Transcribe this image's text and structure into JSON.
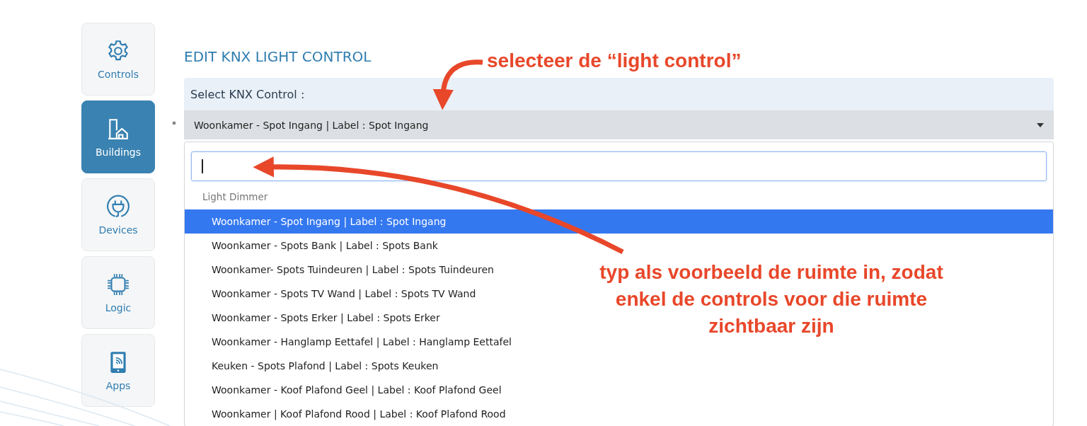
{
  "sidebar": {
    "items": [
      {
        "kind": "gear",
        "label": "Controls",
        "selected": false
      },
      {
        "kind": "building",
        "label": "Buildings",
        "selected": true
      },
      {
        "kind": "plug",
        "label": "Devices",
        "selected": false
      },
      {
        "kind": "chip",
        "label": "Logic",
        "selected": false
      },
      {
        "kind": "tablet",
        "label": "Apps",
        "selected": false
      }
    ]
  },
  "title": "EDIT KNX LIGHT CONTROL",
  "select": {
    "label": "Select KNX Control :",
    "required_mark": "*",
    "value": "Woonkamer - Spot Ingang | Label : Spot Ingang",
    "expanded": true
  },
  "dropdown": {
    "group": "Light Dimmer",
    "options": [
      {
        "label": "Woonkamer - Spot Ingang | Label : Spot Ingang",
        "selected": true
      },
      {
        "label": "Woonkamer - Spots Bank | Label : Spots Bank",
        "selected": false
      },
      {
        "label": "Woonkamer- Spots Tuindeuren | Label : Spots Tuindeuren",
        "selected": false
      },
      {
        "label": "Woonkamer - Spots TV Wand | Label : Spots TV Wand",
        "selected": false
      },
      {
        "label": "Woonkamer - Spots Erker | Label : Spots Erker",
        "selected": false
      },
      {
        "label": "Woonkamer - Hanglamp Eettafel | Label : Hanglamp Eettafel",
        "selected": false
      },
      {
        "label": "Keuken - Spots Plafond | Label : Spots Keuken",
        "selected": false
      },
      {
        "label": "Woonkamer - Koof Plafond Geel | Label : Koof Plafond Geel",
        "selected": false
      },
      {
        "label": "Woonkamer | Koof Plafond Rood | Label : Koof Plafond Rood",
        "selected": false
      }
    ]
  },
  "annotations": [
    {
      "text": "selecteer de “light control”"
    },
    {
      "text": "typ als voorbeeld de ruimte in, zodat enkel de controls voor die ruimte zichtbaar zijn"
    }
  ]
}
